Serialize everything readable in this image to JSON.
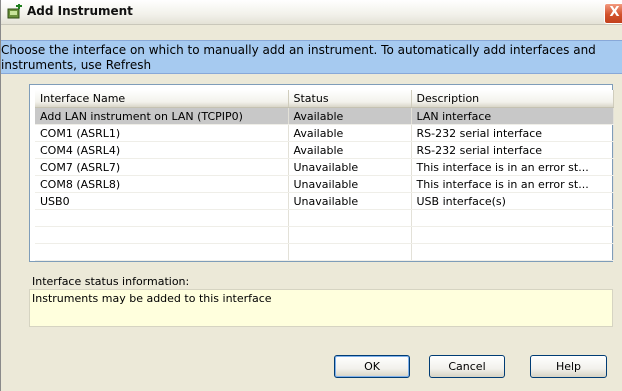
{
  "window": {
    "title": "Add Instrument",
    "close_glyph": "X"
  },
  "instruction_text": "Choose the interface on which to manually add an instrument.  To automatically add interfaces and instruments, use Refresh",
  "table": {
    "columns": [
      "Interface Name",
      "Status",
      "Description"
    ],
    "rows": [
      {
        "name": "Add LAN instrument on LAN (TCPIP0)",
        "status": "Available",
        "description": "LAN interface",
        "selected": true
      },
      {
        "name": "COM1 (ASRL1)",
        "status": "Available",
        "description": "RS-232 serial interface",
        "selected": false
      },
      {
        "name": "COM4 (ASRL4)",
        "status": "Available",
        "description": "RS-232 serial interface",
        "selected": false
      },
      {
        "name": "COM7 (ASRL7)",
        "status": "Unavailable",
        "description": "This interface is in an error st...",
        "selected": false
      },
      {
        "name": "COM8 (ASRL8)",
        "status": "Unavailable",
        "description": "This interface is in an error st...",
        "selected": false
      },
      {
        "name": "USB0",
        "status": "Unavailable",
        "description": "USB interface(s)",
        "selected": false
      },
      {
        "name": "",
        "status": "",
        "description": "",
        "selected": false
      },
      {
        "name": "",
        "status": "",
        "description": "",
        "selected": false
      },
      {
        "name": "",
        "status": "",
        "description": "",
        "selected": false
      }
    ]
  },
  "status_info": {
    "label": "Interface status information:",
    "text": "Instruments may be added to this interface"
  },
  "buttons": {
    "ok": "OK",
    "cancel": "Cancel",
    "help": "Help"
  },
  "colors": {
    "instruction_bg": "#a6caf0",
    "selected_row_bg": "#c8c8c8",
    "status_box_bg": "#ffffdd",
    "close_button": "#d2522c"
  },
  "icons": {
    "app": "add-instrument-icon",
    "close": "close-icon"
  }
}
